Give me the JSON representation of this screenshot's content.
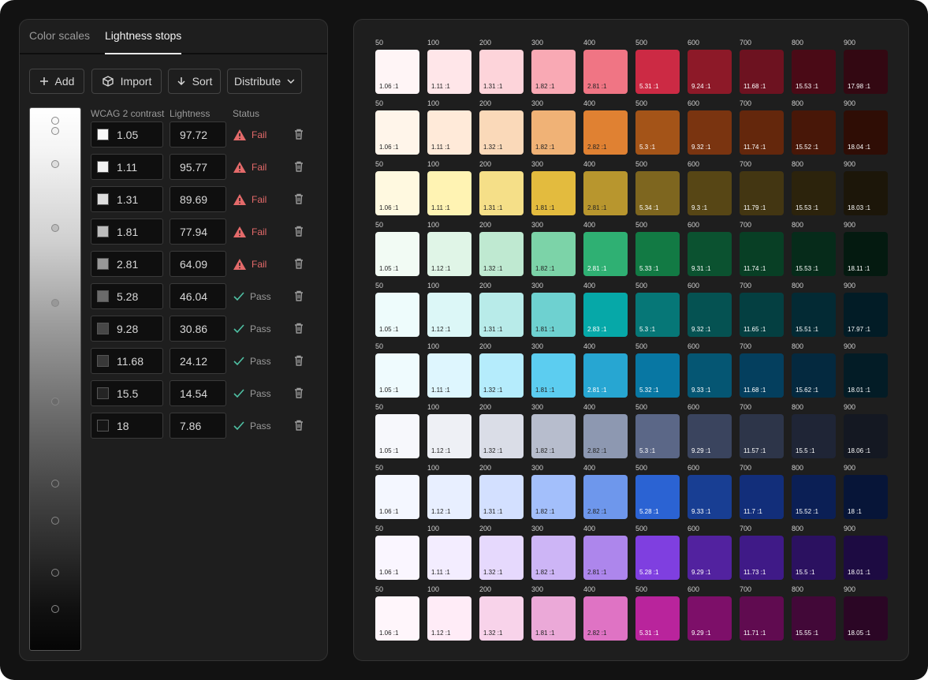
{
  "tabs": [
    "Color scales",
    "Lightness stops"
  ],
  "toolbar": {
    "add": "Add",
    "import": "Import",
    "sort": "Sort",
    "distribute": "Distribute"
  },
  "columns": {
    "contrast": "WCAG 2 contrast",
    "lightness": "Lightness",
    "status": "Status"
  },
  "stops": [
    {
      "contrast": "1.05",
      "lightness": "97.72",
      "status": "Fail",
      "gray": "#f9f9f9"
    },
    {
      "contrast": "1.11",
      "lightness": "95.77",
      "status": "Fail",
      "gray": "#f2f2f2"
    },
    {
      "contrast": "1.31",
      "lightness": "89.69",
      "status": "Fail",
      "gray": "#dedede"
    },
    {
      "contrast": "1.81",
      "lightness": "77.94",
      "status": "Fail",
      "gray": "#bdbdbd"
    },
    {
      "contrast": "2.81",
      "lightness": "64.09",
      "status": "Fail",
      "gray": "#989898"
    },
    {
      "contrast": "5.28",
      "lightness": "46.04",
      "status": "Pass",
      "gray": "#6b6b6b"
    },
    {
      "contrast": "9.28",
      "lightness": "30.86",
      "status": "Pass",
      "gray": "#474747"
    },
    {
      "contrast": "11.68",
      "lightness": "24.12",
      "status": "Pass",
      "gray": "#383838"
    },
    {
      "contrast": "15.5",
      "lightness": "14.54",
      "status": "Pass",
      "gray": "#242424"
    },
    {
      "contrast": "18",
      "lightness": "7.86",
      "status": "Pass",
      "gray": "#151515"
    }
  ],
  "icons": {
    "add": "plus-icon",
    "import": "import-icon",
    "sort": "arrow-down-icon",
    "distribute": "chevron-down-icon",
    "fail": "warning-icon",
    "pass": "check-icon",
    "delete": "trash-icon"
  },
  "colors": {
    "fail": "#e46a6a",
    "pass": "#9a9a9a"
  },
  "step_labels": [
    "50",
    "100",
    "200",
    "300",
    "400",
    "500",
    "600",
    "700",
    "800",
    "900"
  ],
  "scales": [
    {
      "colors": [
        "#fff5f6",
        "#ffe6e9",
        "#fdd4da",
        "#f9a9b4",
        "#f07584",
        "#cc2a44",
        "#8d1928",
        "#6d1220",
        "#4a0a16",
        "#330812"
      ],
      "ratios": [
        "1.06 :1",
        "1.11 :1",
        "1.31 :1",
        "1.82 :1",
        "2.81 :1",
        "5.31 :1",
        "9.24 :1",
        "11.68 :1",
        "15.53 :1",
        "17.98 :1"
      ]
    },
    {
      "colors": [
        "#fff5ea",
        "#ffead9",
        "#fad9b9",
        "#f0b276",
        "#e08132",
        "#a45418",
        "#7a3410",
        "#64270c",
        "#481708",
        "#2f0d05"
      ],
      "ratios": [
        "1.06 :1",
        "1.11 :1",
        "1.32 :1",
        "1.82 :1",
        "2.82 :1",
        "5.3 :1",
        "9.32 :1",
        "11.74 :1",
        "15.52 :1",
        "18.04 :1"
      ]
    },
    {
      "colors": [
        "#fff9e0",
        "#fff3b3",
        "#f5df88",
        "#e3bb3e",
        "#b8962e",
        "#7e661f",
        "#574615",
        "#433612",
        "#2c230c",
        "#1c1609"
      ],
      "ratios": [
        "1.06 :1",
        "1.11 :1",
        "1.31 :1",
        "1.81 :1",
        "2.81 :1",
        "5.34 :1",
        "9.3 :1",
        "11.79 :1",
        "15.53 :1",
        "18.03 :1"
      ]
    },
    {
      "colors": [
        "#f2fbf4",
        "#e0f5e7",
        "#bfe9d1",
        "#7cd3a8",
        "#2fb073",
        "#127a44",
        "#0b5230",
        "#083f25",
        "#062b1a",
        "#041a10"
      ],
      "ratios": [
        "1.05 :1",
        "1.12 :1",
        "1.32 :1",
        "1.82 :1",
        "2.81 :1",
        "5.33 :1",
        "9.31 :1",
        "11.74 :1",
        "15.53 :1",
        "18.11 :1"
      ]
    },
    {
      "colors": [
        "#eefcfc",
        "#dcf7f7",
        "#b8ebe9",
        "#6ed1d0",
        "#06a8a8",
        "#067777",
        "#055252",
        "#043f41",
        "#032a34",
        "#021c26"
      ],
      "ratios": [
        "1.05 :1",
        "1.12 :1",
        "1.31 :1",
        "1.81 :1",
        "2.83 :1",
        "5.3 :1",
        "9.32 :1",
        "11.65 :1",
        "15.51 :1",
        "17.97 :1"
      ]
    },
    {
      "colors": [
        "#effbfe",
        "#def6fe",
        "#b5ecfc",
        "#5ccdf0",
        "#27a6d2",
        "#0877a3",
        "#055673",
        "#043f5e",
        "#04293f",
        "#031c26"
      ],
      "ratios": [
        "1.05 :1",
        "1.11 :1",
        "1.32 :1",
        "1.81 :1",
        "2.81 :1",
        "5.32 :1",
        "9.33 :1",
        "11.68 :1",
        "15.62 :1",
        "18.01 :1"
      ]
    },
    {
      "colors": [
        "#f7f8fc",
        "#eef0f5",
        "#dadde7",
        "#b7bdcd",
        "#8d98b1",
        "#5b6787",
        "#3a445e",
        "#2d3549",
        "#1f2536",
        "#141822"
      ],
      "ratios": [
        "1.05 :1",
        "1.12 :1",
        "1.32 :1",
        "1.82 :1",
        "2.82 :1",
        "5.3 :1",
        "9.29 :1",
        "11.57 :1",
        "15.5 :1",
        "18.06 :1"
      ]
    },
    {
      "colors": [
        "#f4f7ff",
        "#e8efff",
        "#d3e0ff",
        "#a3bffb",
        "#6e97ec",
        "#2b63d3",
        "#183e93",
        "#122e7a",
        "#0b1f55",
        "#071538"
      ],
      "ratios": [
        "1.06 :1",
        "1.12 :1",
        "1.31 :1",
        "1.82 :1",
        "2.82 :1",
        "5.28 :1",
        "9.33 :1",
        "11.7 :1",
        "15.52 :1",
        "18 :1"
      ]
    },
    {
      "colors": [
        "#faf6ff",
        "#f3edff",
        "#e6d9fd",
        "#cdb5f6",
        "#ad86ec",
        "#7f3fe0",
        "#52229f",
        "#3f1a87",
        "#2b1160",
        "#1d0b42"
      ],
      "ratios": [
        "1.06 :1",
        "1.11 :1",
        "1.32 :1",
        "1.82 :1",
        "2.81 :1",
        "5.28 :1",
        "9.29 :1",
        "11.73 :1",
        "15.5 :1",
        "18.01 :1"
      ]
    },
    {
      "colors": [
        "#fff6fb",
        "#ffecf7",
        "#f8d3ea",
        "#eba9d8",
        "#df73c4",
        "#b9249c",
        "#7d0f69",
        "#600b50",
        "#420838",
        "#2b0625"
      ],
      "ratios": [
        "1.06 :1",
        "1.12 :1",
        "1.32 :1",
        "1.81 :1",
        "2.82 :1",
        "5.31 :1",
        "9.29 :1",
        "11.71 :1",
        "15.55 :1",
        "18.05 :1"
      ]
    }
  ]
}
